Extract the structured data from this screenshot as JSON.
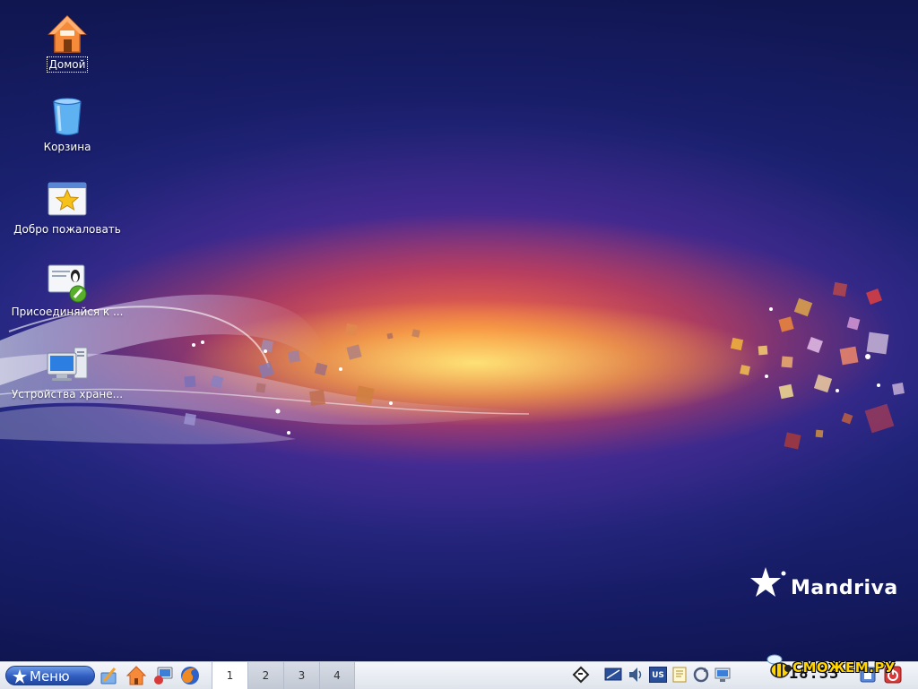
{
  "desktop": {
    "icons": [
      {
        "label": "Домой",
        "selected": true
      },
      {
        "label": "Корзина"
      },
      {
        "label": "Добро пожаловать"
      },
      {
        "label": "Присоединяйся к ..."
      },
      {
        "label": "Устройства хране..."
      }
    ],
    "logo": {
      "text": "Mandriva"
    }
  },
  "taskbar": {
    "menu_label": "Меню",
    "launchers": [
      "configure-icon",
      "home-folder-icon",
      "network-computer-icon",
      "firefox-icon"
    ],
    "workspaces": [
      "1",
      "2",
      "3",
      "4"
    ],
    "active_workspace": "1",
    "tray": [
      "clipboard-icon",
      "display-icon",
      "volume-icon",
      "keyboard-layout-icon",
      "notes-icon",
      "update-icon",
      "network-icon"
    ],
    "keyboard_layout": "US",
    "clock": "18:33",
    "watermark": "СМОЖЕМ.РУ"
  }
}
